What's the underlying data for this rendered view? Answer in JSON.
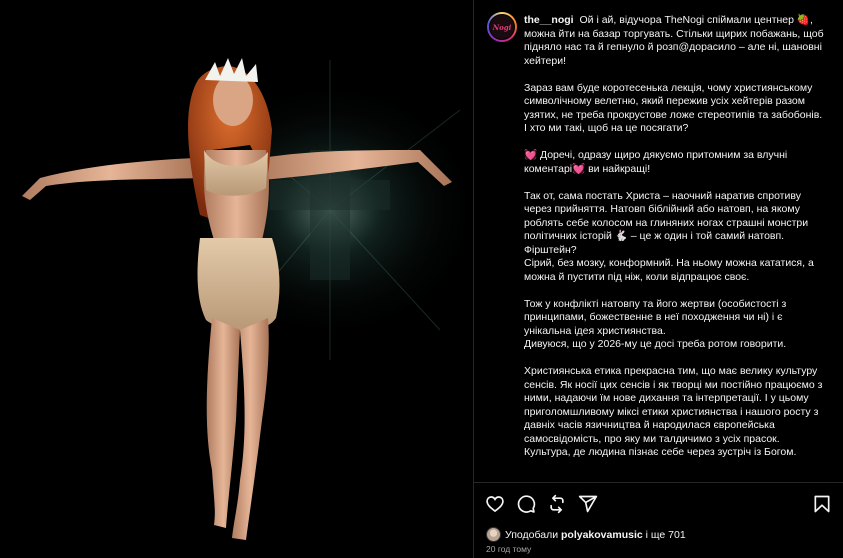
{
  "post": {
    "avatar_text": "Nogi",
    "username": "the__nogi",
    "caption": [
      "Ой і ай, відучора TheNogi спіймали центнер 🍓, можна йти на базар торгувать. Стільки щирих побажань, щоб підняло нас та й гепнуло й розп@дорасило – але ні, шановні хейтери!",
      "Зараз вам буде коротесенька лекція, чому християнському символічному велетню, який пережив усіх хейтерів разом узятих, не треба прокрустове ложе стереотипів та забобонів. І хто ми такі, щоб на це посягати?",
      "💓 Доречі, одразу щиро дякуємо притомним за влучні коментарі💓 ви найкращі!",
      "Так от, сама постать Христа – наочний наратив спротиву через прийняття. Натовп біблійний або натовп, на якому роблять себе колосом на глиняних ногах страшні монстри політичних історій 🐇 – це ж один і той самий натовп. Фірштейн?\nСірий, без мозку, конформний. На ньому можна кататися, а можна й пустити під ніж, коли відпрацює своє.",
      "Тож у конфлікті натовпу та його жертви (особистості з принципами, божественне в неї походження чи ні) і є унікальна ідея християнства.\nДивуюся, що у 2026-му це досі треба ротом говорити.",
      "Християнська етика прекрасна тим, що має велику культуру сенсів. Як носії цих сенсів і як творці ми постійно працюємо з ними, надаючи їм нове дихання та інтерпретації. І у цьому приголомшливому міксі етики християнства і нашого росту з давніх часів язичництва й народилася європейська самосвідомість, про яку ми талдичимо з усіх прасок. Культура, де людина пізнає себе через зустріч із Богом."
    ]
  },
  "actions": {
    "icons": [
      "heart-icon",
      "comment-icon",
      "repost-icon",
      "share-icon",
      "bookmark-icon"
    ],
    "likes_prefix": "Уподобали",
    "likes_user": "polyakovamusic",
    "likes_suffix": "і ще 701",
    "time": "20 год тому"
  }
}
